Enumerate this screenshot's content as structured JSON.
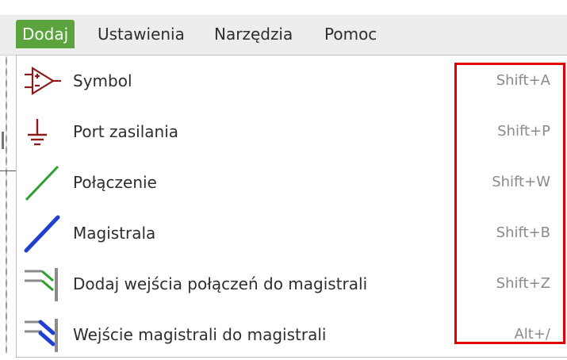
{
  "menubar": {
    "items": [
      {
        "label": "Dodaj",
        "active": true
      },
      {
        "label": "Ustawienia",
        "active": false
      },
      {
        "label": "Narzędzia",
        "active": false
      },
      {
        "label": "Pomoc",
        "active": false
      }
    ]
  },
  "dropdown": {
    "items": [
      {
        "icon": "symbol-icon",
        "label": "Symbol",
        "shortcut": "Shift+A"
      },
      {
        "icon": "power-port-icon",
        "label": "Port zasilania",
        "shortcut": "Shift+P"
      },
      {
        "icon": "wire-icon",
        "label": "Połączenie",
        "shortcut": "Shift+W"
      },
      {
        "icon": "bus-icon",
        "label": "Magistrala",
        "shortcut": "Shift+B"
      },
      {
        "icon": "wire-to-bus-entry-icon",
        "label": "Dodaj wejścia połączeń do magistrali",
        "shortcut": "Shift+Z"
      },
      {
        "icon": "bus-to-bus-entry-icon",
        "label": "Wejście magistrali do magistrali",
        "shortcut": "Alt+/"
      }
    ]
  },
  "colors": {
    "menu_active_bg": "#5aa33d",
    "highlight": "#e30000",
    "symbol_color": "#8b1a1a",
    "wire_color": "#2ca02c",
    "bus_color": "#1f3fcf"
  }
}
